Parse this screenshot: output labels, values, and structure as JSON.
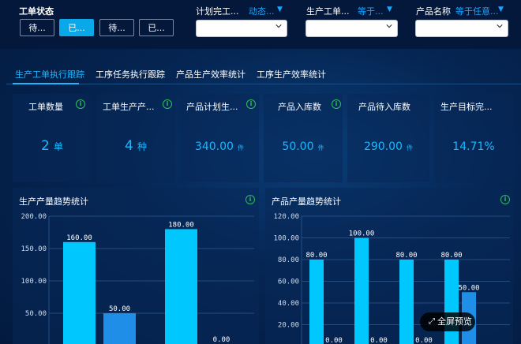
{
  "filter": {
    "status_label": "工单状态",
    "status_options": [
      "待...",
      "已...",
      "待...",
      "已..."
    ],
    "status_active_index": 1,
    "dropdowns": [
      {
        "label": "计划完工...",
        "operator": "动态..."
      },
      {
        "label": "生产工单...",
        "operator": "等于..."
      },
      {
        "label": "产品名称",
        "operator": "等于任意..."
      }
    ]
  },
  "tabs": [
    "生产工单执行跟踪",
    "工序任务执行跟踪",
    "产品生产效率统计",
    "工序生产效率统计"
  ],
  "active_tab": 0,
  "kpis": [
    {
      "title": "工单数量",
      "value": "2",
      "unit": "单"
    },
    {
      "title": "工单生产产...",
      "value": "4",
      "unit": "种"
    },
    {
      "title": "产品计划生...",
      "value": "340.00",
      "unit": "件"
    },
    {
      "title": "产品入库数",
      "value": "50.00",
      "unit": "件"
    },
    {
      "title": "产品待入库数",
      "value": "290.00",
      "unit": "件"
    },
    {
      "title": "生产目标完...",
      "value": "14.71%",
      "unit": ""
    }
  ],
  "fullscreen_label": "全屏预览",
  "colors": {
    "accent": "#1ab8ff",
    "bar_primary": "#00c8ff",
    "bar_secondary": "#1e8ee6",
    "info": "#2bc25b"
  },
  "chart_data": [
    {
      "type": "bar",
      "title": "生产产量趋势统计",
      "ylim": [
        0,
        200
      ],
      "yticks": [
        "200.00",
        "150.00",
        "100.00",
        "50.00"
      ],
      "bars": [
        {
          "value": 160,
          "label": "160.00",
          "series": 0
        },
        {
          "value": 50,
          "label": "50.00",
          "series": 1
        },
        {
          "value": 180,
          "label": "180.00",
          "series": 0
        },
        {
          "value": 0,
          "label": "0.00",
          "series": 1
        }
      ]
    },
    {
      "type": "bar",
      "title": "产品产量趋势统计",
      "ylim": [
        0,
        120
      ],
      "yticks": [
        "120.00",
        "100.00",
        "80.00",
        "60.00",
        "40.00",
        "20.00"
      ],
      "bars": [
        {
          "value": 80,
          "label": "80.00",
          "series": 0
        },
        {
          "value": 0,
          "label": "0.00",
          "series": 1
        },
        {
          "value": 100,
          "label": "100.00",
          "series": 0
        },
        {
          "value": 0,
          "label": "0.00",
          "series": 1
        },
        {
          "value": 80,
          "label": "80.00",
          "series": 0
        },
        {
          "value": 0,
          "label": "0.00",
          "series": 1
        },
        {
          "value": 80,
          "label": "80.00",
          "series": 0
        },
        {
          "value": 50,
          "label": "50.00",
          "series": 1
        }
      ]
    }
  ]
}
